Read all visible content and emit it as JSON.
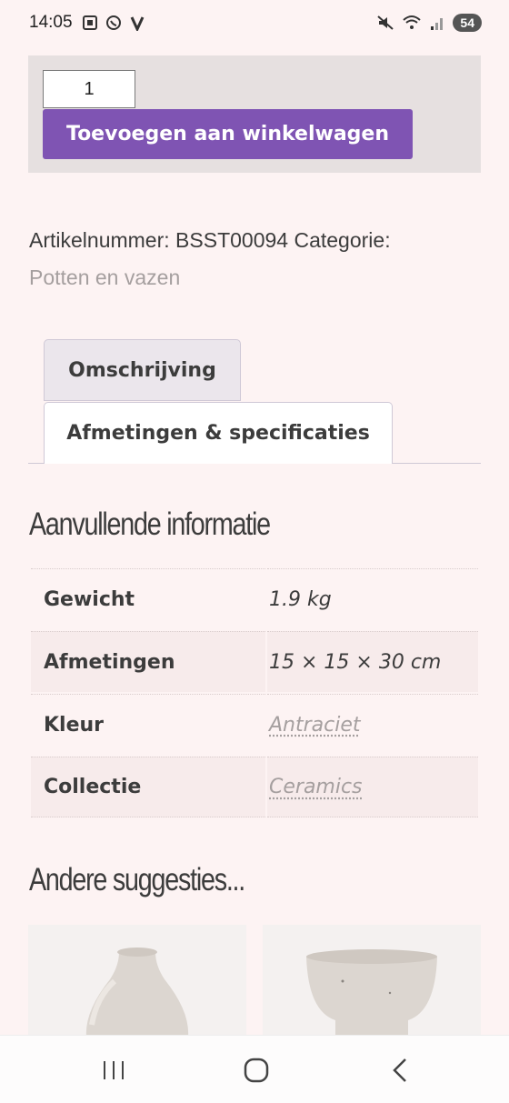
{
  "status_bar": {
    "time": "14:05",
    "battery": "54",
    "left_icons": [
      "screenshot-icon",
      "whatsapp-icon",
      "v-app-icon"
    ],
    "right_icons": [
      "mute-icon",
      "wifi-icon",
      "signal-icon"
    ]
  },
  "cart": {
    "quantity": "1",
    "add_button": "Toevoegen aan winkelwagen",
    "button_color": "#7f54b3"
  },
  "meta": {
    "sku_label": "Artikelnummer:",
    "sku": "BSST00094",
    "category_label": "Categorie:",
    "category": "Potten en vazen"
  },
  "tabs": [
    {
      "label": "Omschrijving",
      "active": false
    },
    {
      "label": "Afmetingen & specificaties",
      "active": true
    }
  ],
  "additional_info": {
    "title": "Aanvullende informatie",
    "rows": [
      {
        "label": "Gewicht",
        "value": "1.9 kg",
        "link": false
      },
      {
        "label": "Afmetingen",
        "value": "15 × 15 × 30 cm",
        "link": false
      },
      {
        "label": "Kleur",
        "value": "Antraciet",
        "link": true
      },
      {
        "label": "Collectie",
        "value": "Ceramics",
        "link": true
      }
    ]
  },
  "suggestions": {
    "title": "Andere suggesties...",
    "products": [
      "vase-image",
      "bowl-image"
    ]
  },
  "nav_bar": {
    "buttons": [
      "recent-apps-icon",
      "home-icon",
      "back-icon"
    ]
  }
}
